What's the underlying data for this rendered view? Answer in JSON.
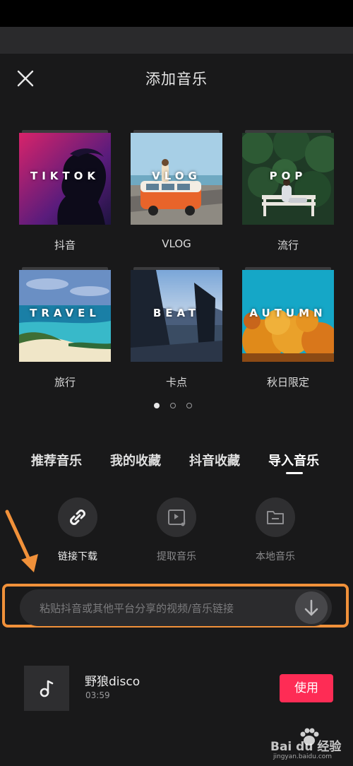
{
  "header": {
    "title": "添加音乐"
  },
  "playlists": [
    {
      "cover_text": "TIKTOK",
      "label": "抖音"
    },
    {
      "cover_text": "VLOG",
      "label": "VLOG"
    },
    {
      "cover_text": "POP",
      "label": "流行"
    },
    {
      "cover_text": "TRAVEL",
      "label": "旅行"
    },
    {
      "cover_text": "BEAT",
      "label": "卡点"
    },
    {
      "cover_text": "AUTUMN",
      "label": "秋日限定"
    }
  ],
  "pagination": {
    "pages": 3,
    "current": 1
  },
  "tabs": [
    {
      "label": "推荐音乐"
    },
    {
      "label": "我的收藏"
    },
    {
      "label": "抖音收藏"
    },
    {
      "label": "导入音乐",
      "active": true
    }
  ],
  "import_tools": [
    {
      "label": "链接下载",
      "icon": "link-icon",
      "active": true
    },
    {
      "label": "提取音乐",
      "icon": "video-music-icon",
      "active": false
    },
    {
      "label": "本地音乐",
      "icon": "folder-icon",
      "active": false
    }
  ],
  "link_input": {
    "placeholder": "粘贴抖音或其他平台分享的视频/音乐链接",
    "value": ""
  },
  "song": {
    "title": "野狼disco",
    "duration": "03:59",
    "action": "使用",
    "icon": "music-note-icon"
  },
  "watermark": {
    "text": "Bai du 经验",
    "sub": "jingyan.baidu.com"
  },
  "colors": {
    "accent": "#fe2c55",
    "highlight": "#f1913a",
    "background": "#19191a"
  }
}
